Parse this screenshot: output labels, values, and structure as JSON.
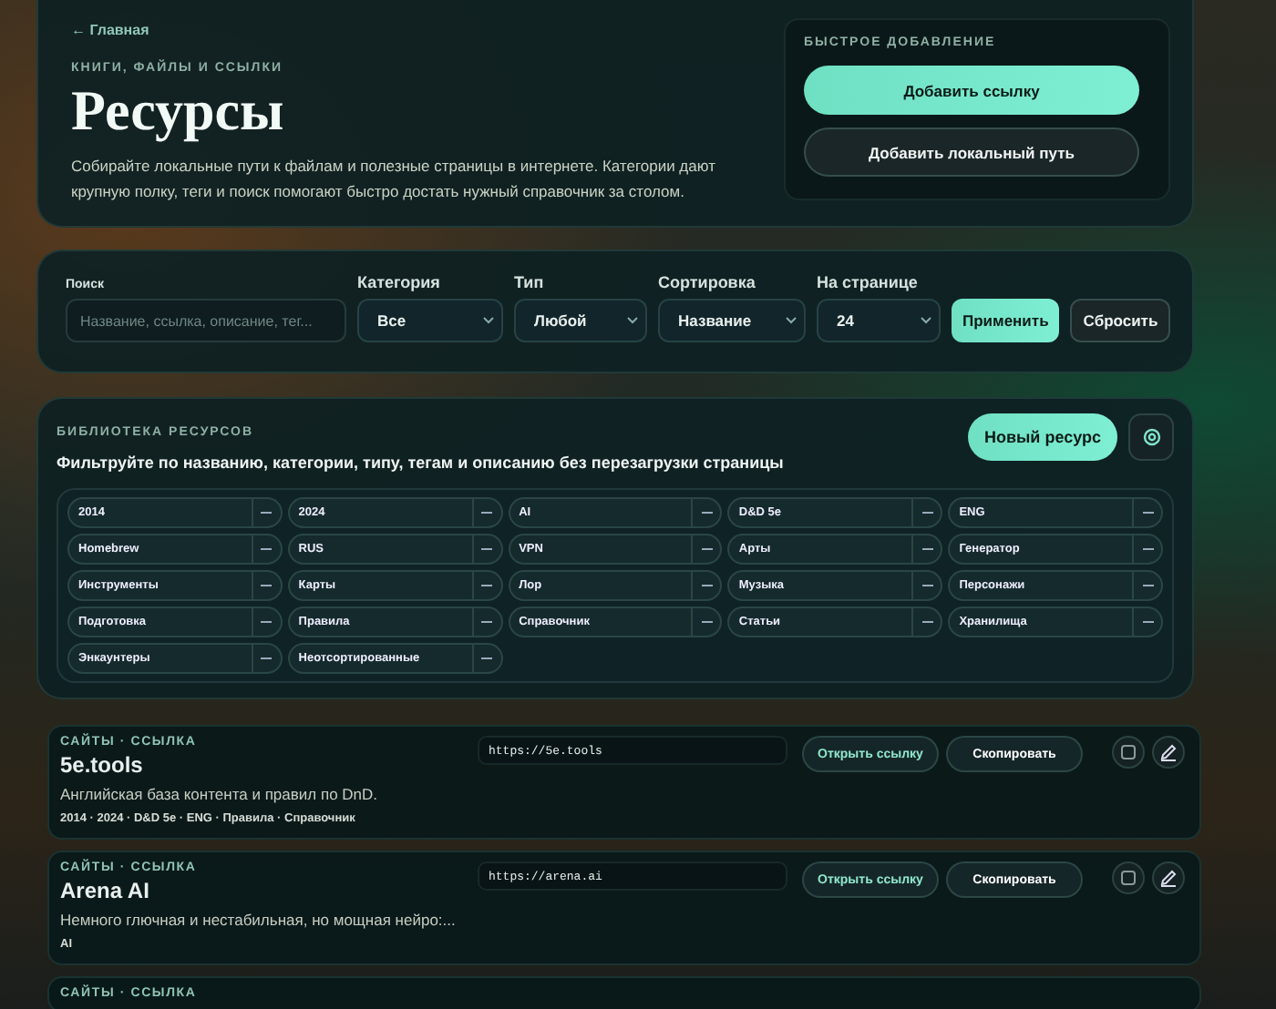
{
  "hero": {
    "back_link": "← Главная",
    "eyebrow": "КНИГИ, ФАЙЛЫ И ССЫЛКИ",
    "title": "Ресурсы",
    "description": "Собирайте локальные пути к файлам и полезные страницы в интернете. Категории дают крупную полку, теги и поиск помогают быстро достать нужный справочник за столом."
  },
  "quick_add": {
    "title": "БЫСТРОЕ ДОБАВЛЕНИЕ",
    "buttons": [
      {
        "label": "Добавить ссылку",
        "kind": "primary"
      },
      {
        "label": "Добавить локальный путь",
        "kind": "secondary"
      }
    ]
  },
  "filters": {
    "search": {
      "label": "Поиск",
      "placeholder": "Название, ссылка, описание, тег..."
    },
    "selects": [
      {
        "label": "Категория",
        "value": "Все"
      },
      {
        "label": "Тип",
        "value": "Любой"
      },
      {
        "label": "Сортировка",
        "value": "Название"
      },
      {
        "label": "На странице",
        "value": "24"
      }
    ],
    "buttons": [
      {
        "label": "Применить",
        "kind": "primary"
      },
      {
        "label": "Сбросить",
        "kind": "secondary"
      }
    ]
  },
  "library": {
    "eyebrow": "БИБЛИОТЕКА РЕСУРСОВ",
    "subtitle": "Фильтруйте по названию, категории, типу, тегам и описанию без перезагрузки страницы",
    "new_button": "Новый ресурс",
    "tags": [
      {
        "label": "2014"
      },
      {
        "label": "2024"
      },
      {
        "label": "AI"
      },
      {
        "label": "D&D 5e"
      },
      {
        "label": "ENG"
      },
      {
        "label": "Homebrew"
      },
      {
        "label": "RUS"
      },
      {
        "label": "VPN"
      },
      {
        "label": "Арты"
      },
      {
        "label": "Генератор"
      },
      {
        "label": "Инструменты"
      },
      {
        "label": "Карты"
      },
      {
        "label": "Лор"
      },
      {
        "label": "Музыка"
      },
      {
        "label": "Персонажи"
      },
      {
        "label": "Подготовка"
      },
      {
        "label": "Правила"
      },
      {
        "label": "Справочник"
      },
      {
        "label": "Статьи"
      },
      {
        "label": "Хранилища"
      },
      {
        "label": "Энкаунтеры"
      },
      {
        "label": "Неотсортированные"
      }
    ]
  },
  "resources": [
    {
      "meta": "САЙТЫ · ССЫЛКА",
      "title": "5e.tools",
      "url": "https://5e.tools",
      "description": "Английская база контента и правил по DnD.",
      "tags": "2014 · 2024 · D&D 5e · ENG · Правила · Справочник",
      "open_label": "Открыть ссылку",
      "copy_label": "Скопировать",
      "checked": false
    },
    {
      "meta": "САЙТЫ · ССЫЛКА",
      "title": "Arena AI",
      "url": "https://arena.ai",
      "description": "Немного глючная и нестабильная, но мощная нейро:...",
      "tags": "AI",
      "open_label": "Открыть ссылку",
      "copy_label": "Скопировать",
      "checked": false
    },
    {
      "meta": "САЙТЫ · ССЫЛКА"
    }
  ]
}
